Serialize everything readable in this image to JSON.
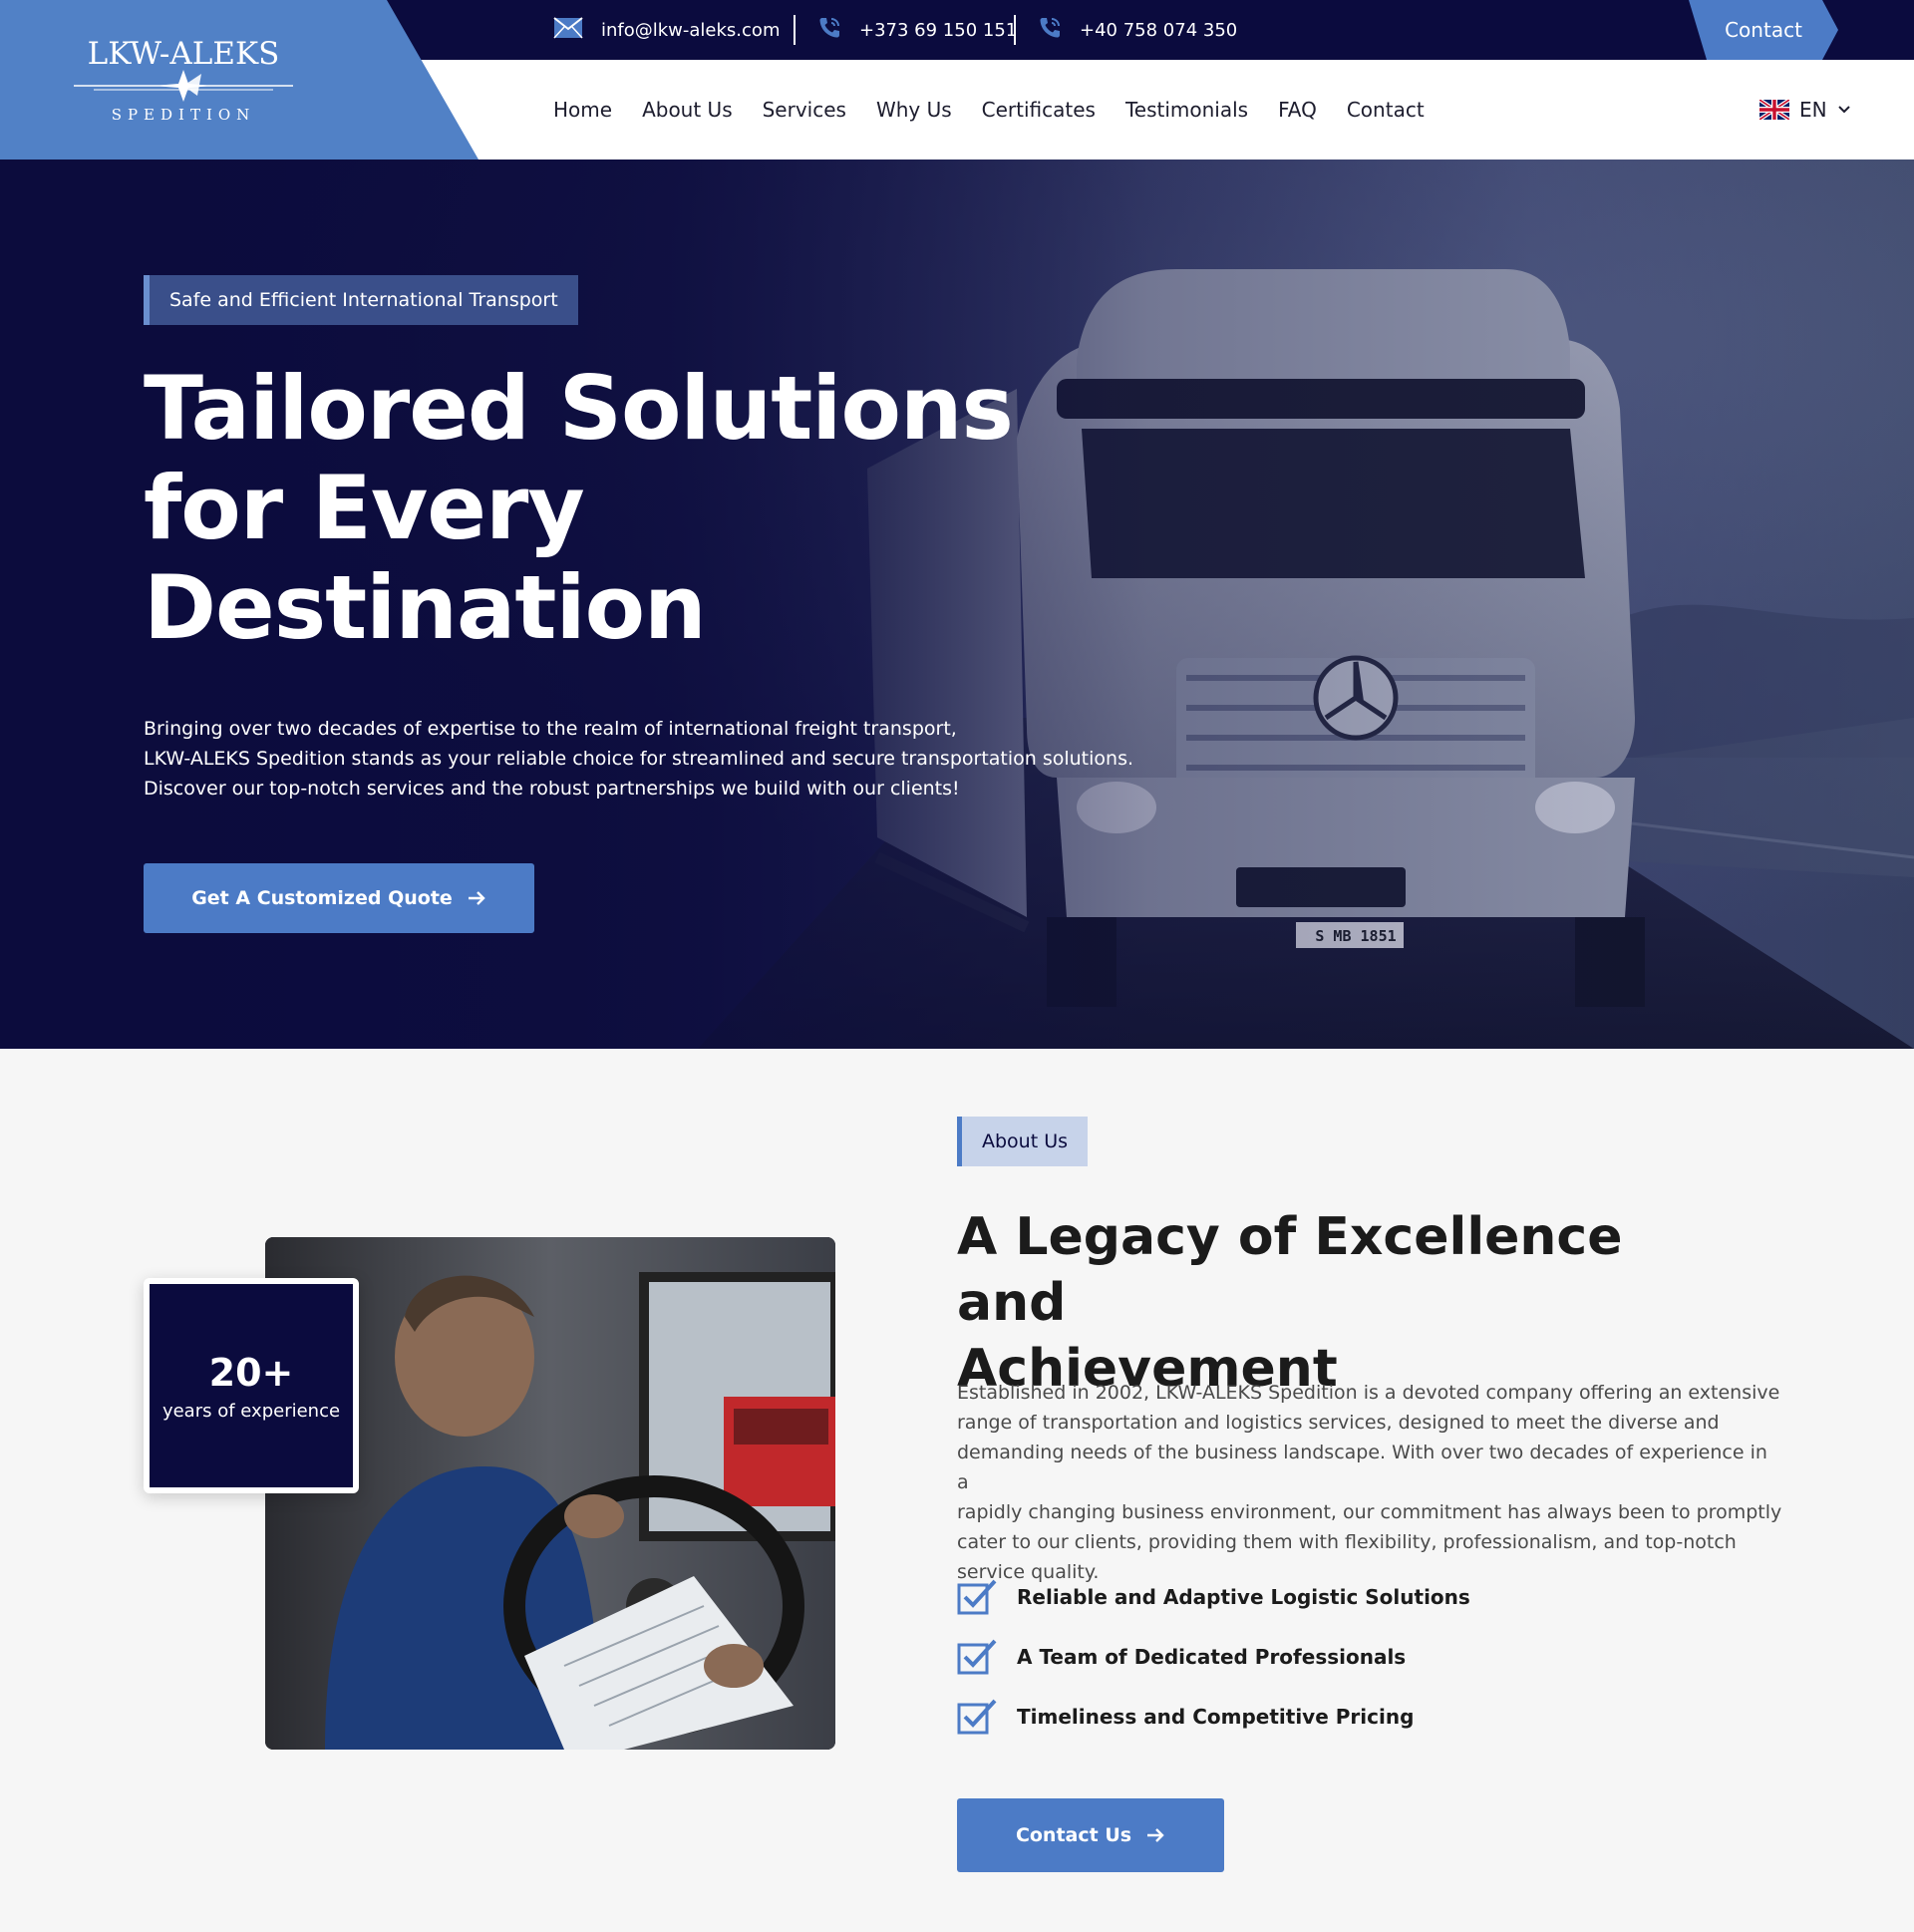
{
  "topbar": {
    "email": "info@lkw-aleks.com",
    "phone1": "+373 69 150 151",
    "phone2": "+40 758 074 350",
    "contact_label": "Contact"
  },
  "logo": {
    "name": "LKW-ALEKS",
    "subtitle": "SPEDITION"
  },
  "nav": {
    "items": [
      "Home",
      "About Us",
      "Services",
      "Why Us",
      "Certificates",
      "Testimonials",
      "FAQ",
      "Contact"
    ],
    "language": "EN"
  },
  "hero": {
    "badge": "Safe and Efficient International Transport",
    "title_lines": [
      "Tailored Solutions",
      "for Every",
      "Destination"
    ],
    "text_lines": [
      "Bringing over two decades of expertise to the realm of international freight transport,",
      "LKW-ALEKS Spedition stands as your reliable choice for streamlined and secure transportation solutions.",
      "Discover our top-notch services and the robust partnerships we build with our clients!"
    ],
    "cta_label": "Get A Customized Quote",
    "plate": "S MB 1851"
  },
  "about": {
    "badge": "About Us",
    "title_lines": [
      "A Legacy of Excellence and",
      "Achievement"
    ],
    "experience_number": "20+",
    "experience_label": "years of experience",
    "text_lines": [
      "Established in 2002, LKW-ALEKS Spedition is a devoted company offering an extensive",
      "range of transportation and logistics services, designed to meet the diverse and",
      "demanding needs of the business landscape. With over two decades of experience in a",
      "rapidly changing business environment, our commitment has always been to promptly",
      "cater to our clients, providing them with flexibility, professionalism, and top-notch",
      "service quality."
    ],
    "features": [
      "Reliable and Adaptive Logistic Solutions",
      "A Team of Dedicated Professionals",
      "Timeliness and Competitive Pricing"
    ],
    "cta_label": "Contact Us"
  },
  "colors": {
    "navy": "#0b0b3e",
    "accent": "#4c7bc6",
    "logo_panel": "#5181c6",
    "badge_bg": "#c7d3ea"
  },
  "icons": [
    "envelope-icon",
    "phone-icon",
    "uk-flag-icon",
    "chevron-down-icon",
    "arrow-right-icon",
    "checkbox-icon",
    "compass-star-icon"
  ]
}
